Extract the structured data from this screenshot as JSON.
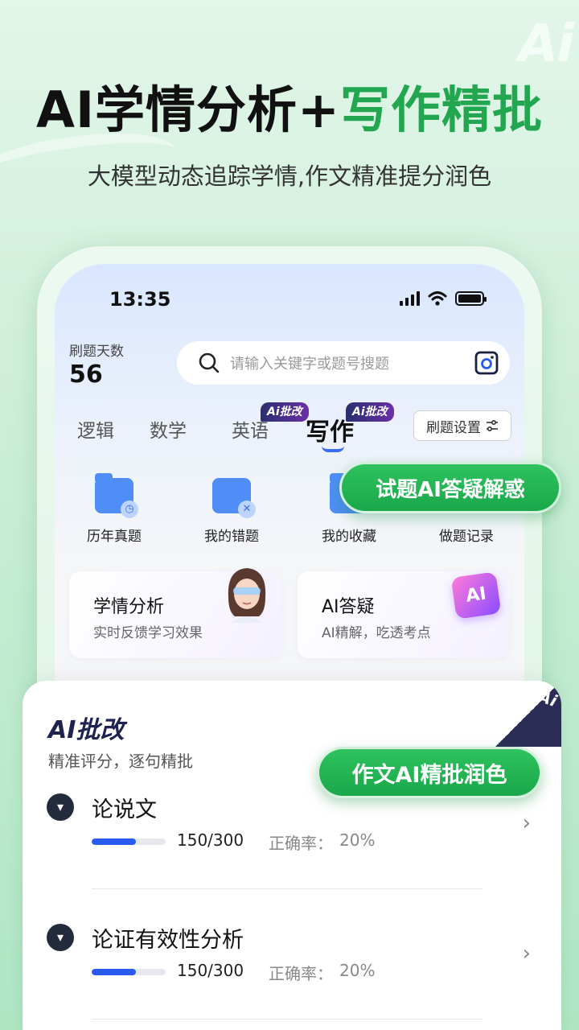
{
  "promo": {
    "headline_black": "AI学情分析+",
    "headline_green": "写作精批",
    "subline": "大模型动态追踪学情,作文精准提分润色",
    "deco_text": "Ai"
  },
  "status_bar": {
    "time": "13:35"
  },
  "header": {
    "days_label": "刷题天数",
    "days_value": "56",
    "search_placeholder": "请输入关键字或题号搜题"
  },
  "tabs": [
    {
      "label": "逻辑",
      "active": false
    },
    {
      "label": "数学",
      "active": false
    },
    {
      "label": "英语",
      "active": false,
      "badge": "Ai批改"
    },
    {
      "label": "写作",
      "active": true,
      "badge": "Ai批改"
    }
  ],
  "quiz_settings_label": "刷题设置",
  "quick_actions": [
    {
      "label": "历年真题",
      "icon": "folder-clock-icon"
    },
    {
      "label": "我的错题",
      "icon": "file-error-icon"
    },
    {
      "label": "我的收藏",
      "icon": "folder-star-icon"
    },
    {
      "label": "做题记录",
      "icon": "record-icon"
    }
  ],
  "feature_cards": [
    {
      "title": "学情分析",
      "subtitle": "实时反馈学习效果"
    },
    {
      "title": "AI答疑",
      "subtitle": "AI精解，吃透考点",
      "badge": "AI"
    }
  ],
  "callouts": {
    "qa": "试题AI答疑解惑",
    "essay": "作文AI精批润色"
  },
  "grading": {
    "title": "AI批改",
    "subtitle": "精准评分，逐句精批",
    "corner_badge": "Ai",
    "rate_label": "正确率：",
    "rows": [
      {
        "title": "论说文",
        "count": "150/300",
        "rate": "20%",
        "progress": 0.6
      },
      {
        "title": "论证有效性分析",
        "count": "150/300",
        "rate": "20%",
        "progress": 0.6
      }
    ]
  },
  "colors": {
    "accent_green": "#22a650",
    "accent_blue": "#3b6cf6",
    "badge_purple": "#6a2fa8"
  }
}
